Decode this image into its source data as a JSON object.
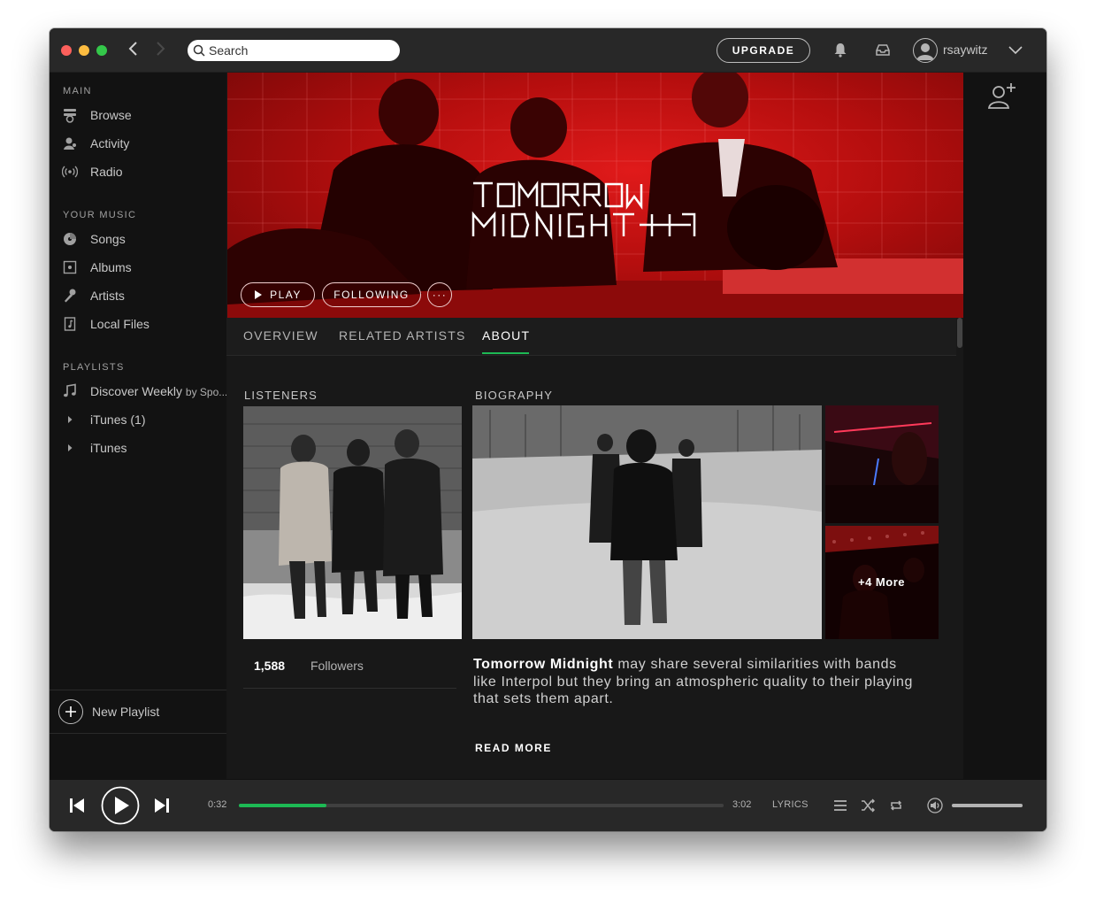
{
  "titlebar": {
    "search_placeholder": "Search",
    "upgrade_label": "UPGRADE",
    "username": "rsaywitz"
  },
  "sidebar": {
    "sections": [
      {
        "heading": "MAIN"
      },
      {
        "heading": "YOUR MUSIC"
      },
      {
        "heading": "PLAYLISTS"
      }
    ],
    "main_items": [
      {
        "label": "Browse",
        "icon": "browse-icon"
      },
      {
        "label": "Activity",
        "icon": "activity-icon"
      },
      {
        "label": "Radio",
        "icon": "radio-icon"
      }
    ],
    "music_items": [
      {
        "label": "Songs",
        "icon": "songs-icon"
      },
      {
        "label": "Albums",
        "icon": "albums-icon"
      },
      {
        "label": "Artists",
        "icon": "artists-icon"
      },
      {
        "label": "Local Files",
        "icon": "local-files-icon"
      }
    ],
    "playlists": [
      {
        "label": "Discover Weekly",
        "by": "by Spo...",
        "icon": "music-note-icon"
      },
      {
        "label": "iTunes (1)",
        "icon": "disclosure-triangle-icon"
      },
      {
        "label": "iTunes",
        "icon": "disclosure-triangle-icon"
      }
    ],
    "new_playlist_label": "New Playlist"
  },
  "artist": {
    "name": "TOMORROW MIDNIGHT",
    "play_label": "PLAY",
    "following_label": "FOLLOWING",
    "more_label": "···"
  },
  "tabs": [
    {
      "label": "OVERVIEW",
      "active": false
    },
    {
      "label": "RELATED ARTISTS",
      "active": false
    },
    {
      "label": "ABOUT",
      "active": true
    }
  ],
  "about": {
    "listeners_heading": "LISTENERS",
    "biography_heading": "BIOGRAPHY",
    "followers_count": "1,588",
    "followers_label": "Followers",
    "more_photos": "+4 More",
    "bio_name": "Tomorrow Midnight",
    "bio_text": " may share several similarities with bands like Interpol but they bring an atmospheric quality to their playing that sets them apart.",
    "read_more": "READ MORE"
  },
  "player": {
    "elapsed": "0:32",
    "duration": "3:02",
    "progress_percent": 18,
    "lyrics_label": "LYRICS",
    "volume_percent": 100
  },
  "colors": {
    "accent": "#1db954",
    "hero_red": "#c41212",
    "background": "#181818",
    "sidebar": "#121212"
  }
}
